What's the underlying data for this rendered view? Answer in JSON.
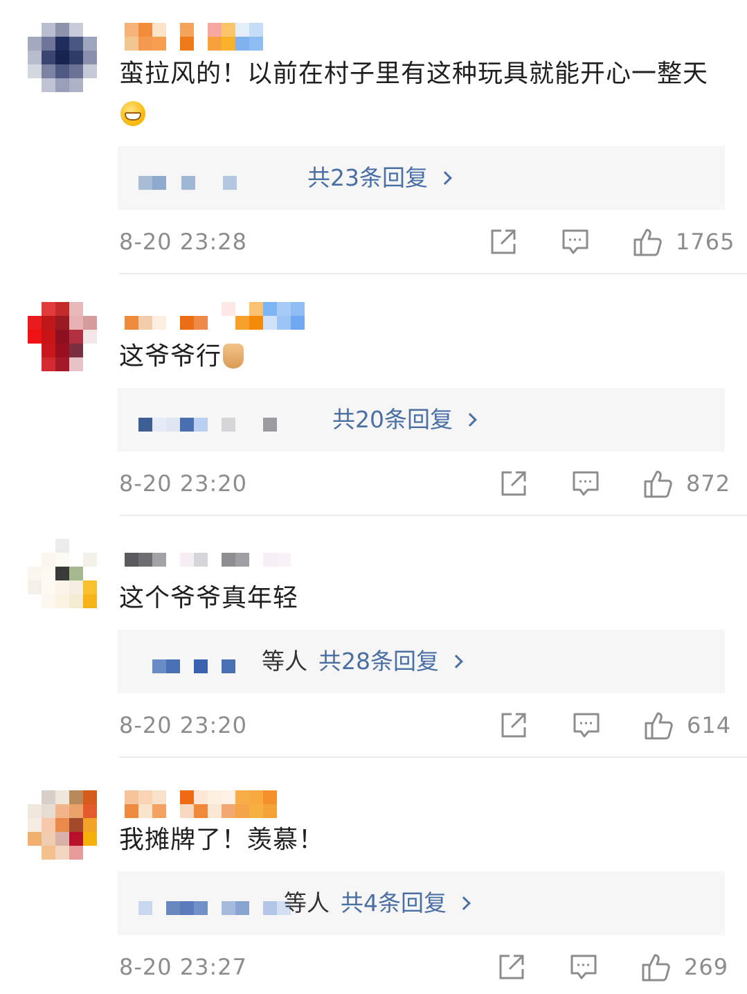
{
  "comments": [
    {
      "text": "蛮拉风的！以前在村子里有这种玩具就能开心一整天",
      "emoji_icon": "grinning-face-emoji",
      "reply_prefix": "",
      "reply_label": "共23条回复",
      "timestamp": "8-20 23:28",
      "likes": "1765"
    },
    {
      "text": "这爷爷行",
      "emoji_icon": "rock-on-hand-emoji",
      "reply_prefix": "",
      "reply_label": "共20条回复",
      "timestamp": "8-20 23:20",
      "likes": "872"
    },
    {
      "text": "这个爷爷真年轻",
      "emoji_icon": "",
      "reply_prefix": "等人",
      "reply_label": "共28条回复",
      "timestamp": "8-20 23:20",
      "likes": "614"
    },
    {
      "text": "我摊牌了！羡慕！",
      "emoji_icon": "",
      "reply_prefix": "等人",
      "reply_label": "共4条回复",
      "timestamp": "8-20 23:27",
      "likes": "269"
    }
  ],
  "icons": {
    "share": "share-icon",
    "comment": "comment-icon",
    "like": "thumbs-up-icon"
  },
  "colors": {
    "link": "#4a6fa5",
    "meta": "#8c8c8c",
    "reply_bg": "#f6f6f6"
  }
}
